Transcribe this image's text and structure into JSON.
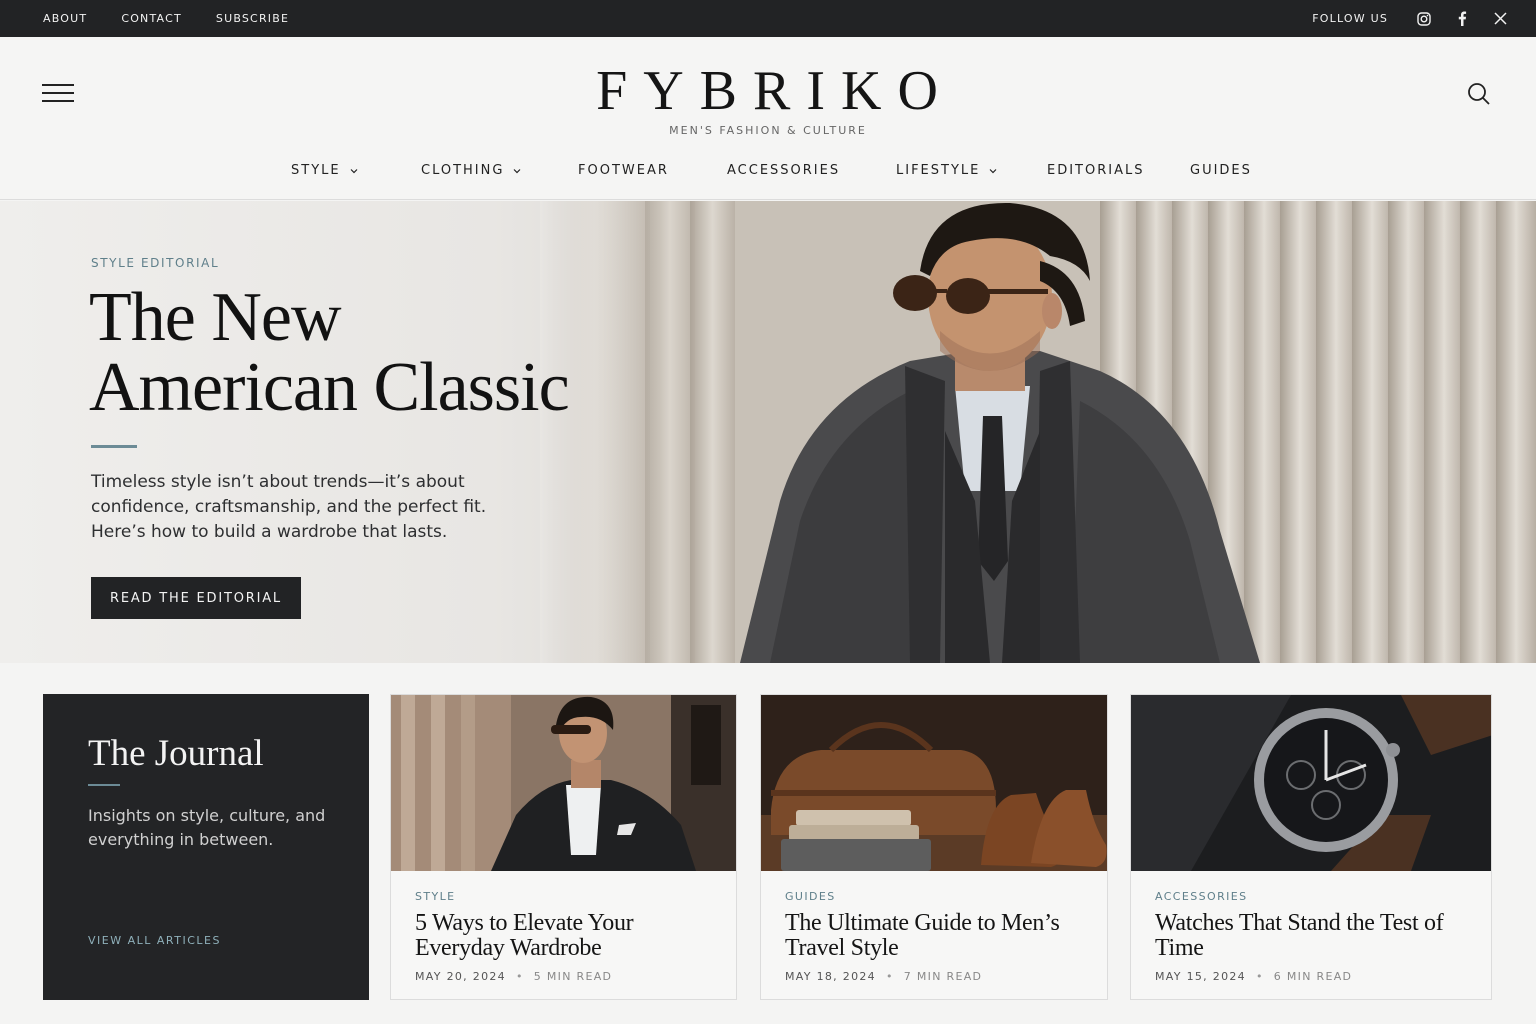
{
  "topbar": {
    "links": [
      "ABOUT",
      "CONTACT",
      "SUBSCRIBE"
    ],
    "follow_label": "FOLLOW US",
    "social_icons": [
      "instagram-icon",
      "facebook-icon",
      "x-icon"
    ]
  },
  "header": {
    "logo": "FYBRIKO",
    "tagline": "MEN'S FASHION & CULTURE",
    "icons": [
      "hamburger-menu-icon",
      "search-icon"
    ]
  },
  "nav": {
    "items": [
      {
        "label": "STYLE",
        "has_dropdown": true
      },
      {
        "label": "CLOTHING",
        "has_dropdown": true
      },
      {
        "label": "FOOTWEAR",
        "has_dropdown": false
      },
      {
        "label": "ACCESSORIES",
        "has_dropdown": false
      },
      {
        "label": "LIFESTYLE",
        "has_dropdown": true
      },
      {
        "label": "EDITORIALS",
        "has_dropdown": false
      },
      {
        "label": "GUIDES",
        "has_dropdown": false
      }
    ]
  },
  "hero": {
    "label": "STYLE EDITORIAL",
    "title_line1": "The New",
    "title_line2": "American Classic",
    "description": "Timeless style isn’t about trends—it’s about confidence, craftsmanship, and the perfect fit. Here’s how to build a wardrobe that lasts.",
    "button": "READ THE EDITORIAL"
  },
  "journal": {
    "title": "The Journal",
    "description": "Insights on style, culture, and everything in between.",
    "link": "VIEW ALL ARTICLES"
  },
  "articles": [
    {
      "category": "STYLE",
      "title": "5 Ways to Elevate Your Everyday Wardrobe",
      "date": "MAY 20, 2024",
      "read_time": "5 MIN READ"
    },
    {
      "category": "GUIDES",
      "title": "The Ultimate Guide to Men’s Travel Style",
      "date": "MAY 18, 2024",
      "read_time": "7 MIN READ"
    },
    {
      "category": "ACCESSORIES",
      "title": "Watches That Stand the Test of Time",
      "date": "MAY 15, 2024",
      "read_time": "6 MIN READ"
    }
  ],
  "colors": {
    "dark": "#222325",
    "accent": "#5f7f8a",
    "background": "#f4f4f3"
  }
}
